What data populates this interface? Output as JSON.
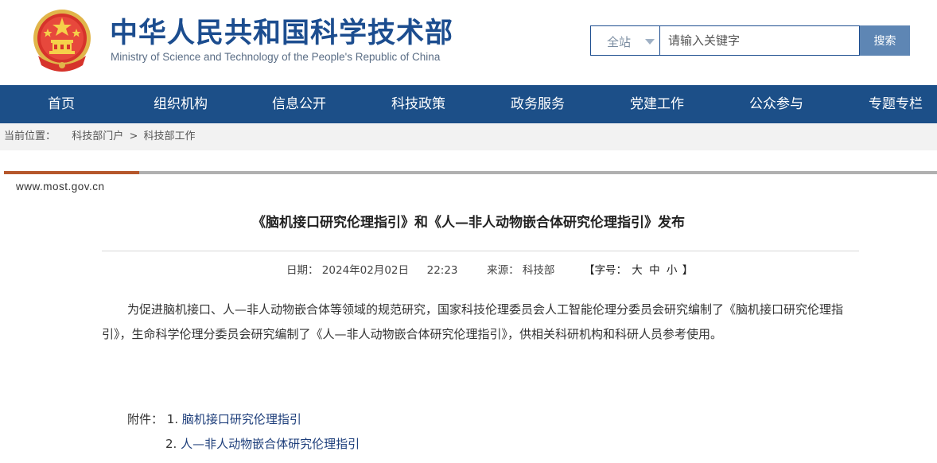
{
  "header": {
    "title": "中华人民共和国科学技术部",
    "subtitle": "Ministry of Science and Technology of the People's Republic of China",
    "emblem_icon": "national-emblem-icon"
  },
  "search": {
    "scope": "全站",
    "placeholder": "请输入关键字",
    "button_label": "搜索"
  },
  "nav": {
    "items": [
      "首页",
      "组织机构",
      "信息公开",
      "科技政策",
      "政务服务",
      "党建工作",
      "公众参与",
      "专题专栏"
    ]
  },
  "breadcrumb": {
    "label": "当前位置：",
    "items": [
      "科技部门户",
      "科技部工作"
    ],
    "separator": ">"
  },
  "article": {
    "site_url": "www.most.gov.cn",
    "title": "《脑机接口研究伦理指引》和《人—非人动物嵌合体研究伦理指引》发布",
    "date_label": "日期：",
    "date": "2024年02月02日",
    "time": "22:23",
    "source_label": "来源：",
    "source": "科技部",
    "font_size_prefix": "【字号：",
    "font_sizes": [
      "大",
      "中",
      "小"
    ],
    "font_size_suffix": "】",
    "body": "为促进脑机接口、人—非人动物嵌合体等领域的规范研究，国家科技伦理委员会人工智能伦理分委员会研究编制了《脑机接口研究伦理指引》，生命科学伦理分委员会研究编制了《人—非人动物嵌合体研究伦理指引》，供相关科研机构和科研人员参考使用。",
    "attachments_label": "附件：",
    "attachments": [
      {
        "index": "1.",
        "label": "脑机接口研究伦理指引"
      },
      {
        "index": "2.",
        "label": "人—非人动物嵌合体研究伦理指引"
      }
    ]
  },
  "colors": {
    "brand_blue": "#1c4f88",
    "title_blue": "#1c4d8f",
    "accent_rust": "#b5572b",
    "search_button": "#5e86b4"
  }
}
